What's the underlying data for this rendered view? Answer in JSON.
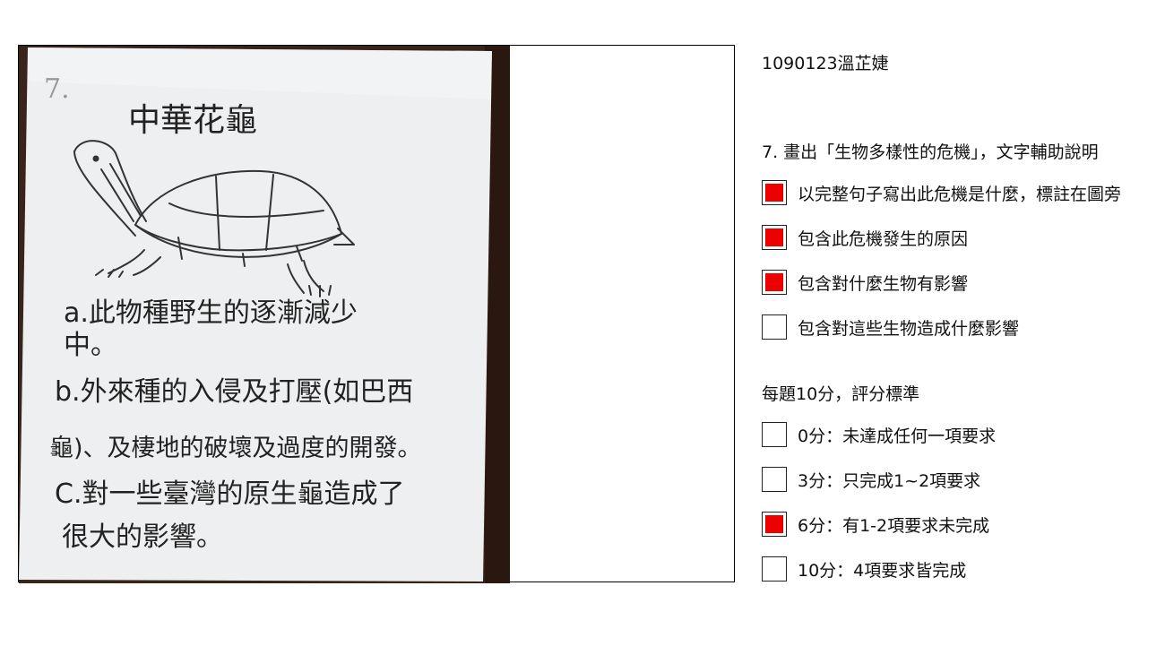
{
  "photo": {
    "page_number": "7.",
    "title": "中華花龜",
    "lines": [
      "a.此物種野生的逐漸減少",
      "中。",
      "b.外來種的入侵及打壓(如巴西",
      "龜)、及棲地的破壞及過度的開發。",
      "C.對一些臺灣的原生龜造成了",
      "很大的影響。"
    ]
  },
  "panel": {
    "student_name": "1090123溫芷婕",
    "question": "7. 畫出「生物多樣性的危機」，文字輔助說明",
    "criteria": [
      {
        "label": "以完整句子寫出此危機是什麼，標註在圖旁",
        "checked": true
      },
      {
        "label": "包含此危機發生的原因",
        "checked": true
      },
      {
        "label": "包含對什麼生物有影響",
        "checked": true
      },
      {
        "label": "包含對這些生物造成什麼影響",
        "checked": false
      }
    ],
    "scoring_title": "每題10分，評分標準",
    "scores": [
      {
        "label": "0分：未達成任何一項要求",
        "checked": false
      },
      {
        "label": "3分：只完成1~2項要求",
        "checked": false
      },
      {
        "label": "6分：有1-2項要求未完成",
        "checked": true
      },
      {
        "label": "10分：4項要求皆完成",
        "checked": false
      }
    ]
  },
  "colors": {
    "check_fill": "#ee0000",
    "background_dark": "#3a2318"
  }
}
